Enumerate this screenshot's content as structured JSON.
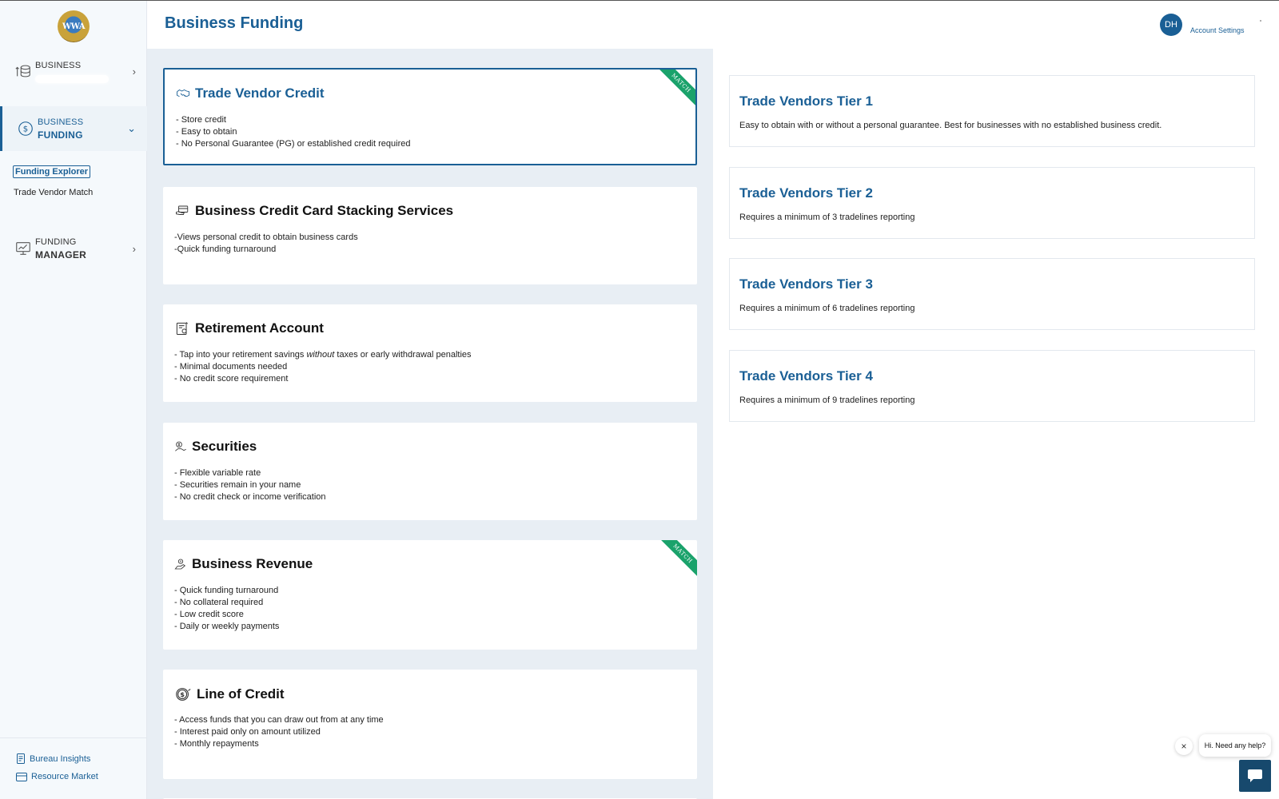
{
  "logo": {
    "text": "WWA"
  },
  "sidebar": {
    "business": {
      "top": "BUSINESS",
      "chevron": "›"
    },
    "funding": {
      "top": "BUSINESS",
      "bottom": "FUNDING",
      "chevron": "⌄"
    },
    "subnav": [
      "Funding Explorer",
      "Trade Vendor Match"
    ],
    "manager": {
      "top": "FUNDING",
      "bottom": "MANAGER",
      "chevron": "›"
    },
    "footer": [
      "Bureau Insights",
      "Resource Market"
    ]
  },
  "header": {
    "title": "Business Funding",
    "avatar_initials": "DH",
    "account_settings": "Account Settings"
  },
  "funding_cards": [
    {
      "title": "Trade Vendor Credit",
      "icon": "handshake-icon",
      "bullets": [
        "- Store credit",
        "- Easy to obtain",
        "- No Personal Guarantee (PG) or established credit required"
      ],
      "badge": "MATCH"
    },
    {
      "title": "Business Credit Card Stacking Services",
      "icon": "credit-card-hand-icon",
      "bullets": [
        "-Views personal credit to obtain business cards",
        "-Quick funding turnaround"
      ]
    },
    {
      "title": "Retirement Account",
      "icon": "retirement-piggy-icon",
      "bullets_parts": {
        "line1_a": "- Tap into your retirement savings ",
        "line1_em": "without",
        "line1_b": " taxes or early withdrawal penalties"
      },
      "bullets": [
        "- Minimal documents needed",
        "- No credit score requirement"
      ]
    },
    {
      "title": "Securities",
      "icon": "securities-icon",
      "bullets": [
        "- Flexible variable rate",
        "- Securities remain in your name",
        "- No credit check or income verification"
      ]
    },
    {
      "title": "Business Revenue",
      "icon": "revenue-hand-icon",
      "bullets": [
        "- Quick funding turnaround",
        "- No collateral required",
        "- Low credit score",
        "- Daily or weekly payments"
      ],
      "badge": "MATCH"
    },
    {
      "title": "Line of Credit",
      "icon": "dollar-coin-icon",
      "bullets": [
        "- Access funds that you can draw out from at any time",
        "- Interest paid only on amount utilized",
        "- Monthly repayments"
      ]
    }
  ],
  "tiers": [
    {
      "title": "Trade Vendors Tier 1",
      "desc": "Easy to obtain with or without a personal guarantee. Best for businesses with no established business credit."
    },
    {
      "title": "Trade Vendors Tier 2",
      "desc": "Requires a minimum of 3 tradelines reporting"
    },
    {
      "title": "Trade Vendors Tier 3",
      "desc": "Requires a minimum of 6 tradelines reporting"
    },
    {
      "title": "Trade Vendors Tier 4",
      "desc": "Requires a minimum of 9 tradelines reporting"
    }
  ],
  "chat": {
    "close": "×",
    "bubble": "Hi. Need any help?"
  },
  "colors": {
    "brand": "#1a5f95",
    "match": "#1aa26b",
    "panel_bg": "#e8eef4",
    "sidebar_bg": "#f5f9fc"
  }
}
